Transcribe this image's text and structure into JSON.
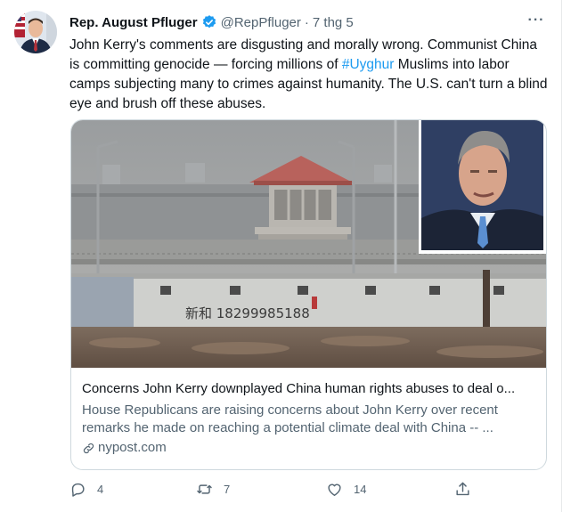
{
  "tweet": {
    "author_name": "Rep. August Pfluger",
    "handle": "@RepPfluger",
    "separator": "·",
    "time": "7 thg 5",
    "more_label": "···",
    "text_before": "John Kerry's comments are disgusting and morally wrong. Communist China is committing genocide — forcing millions of ",
    "hashtag": "#Uyghur",
    "text_after": " Muslims into labor camps subjecting many to crimes against humanity. The U.S. can't turn a blind eye and brush off these abuses."
  },
  "card": {
    "title": "Concerns John Kerry downplayed China human rights abuses to deal o...",
    "description": "House Republicans are raising concerns about John Kerry over recent remarks he made on reaching a potential climate deal with China -- ...",
    "domain": "nypost.com",
    "wall_writing": "新和 18299985188"
  },
  "actions": {
    "reply_count": "4",
    "retweet_count": "7",
    "like_count": "14"
  },
  "icons": {
    "verified": "verified-badge-icon",
    "reply": "reply-icon",
    "retweet": "retweet-icon",
    "like": "heart-icon",
    "share": "share-icon",
    "link": "link-icon"
  },
  "colors": {
    "accent": "#1d9bf0",
    "text": "#0f1419",
    "secondary": "#536471",
    "border": "#cfd9de"
  }
}
